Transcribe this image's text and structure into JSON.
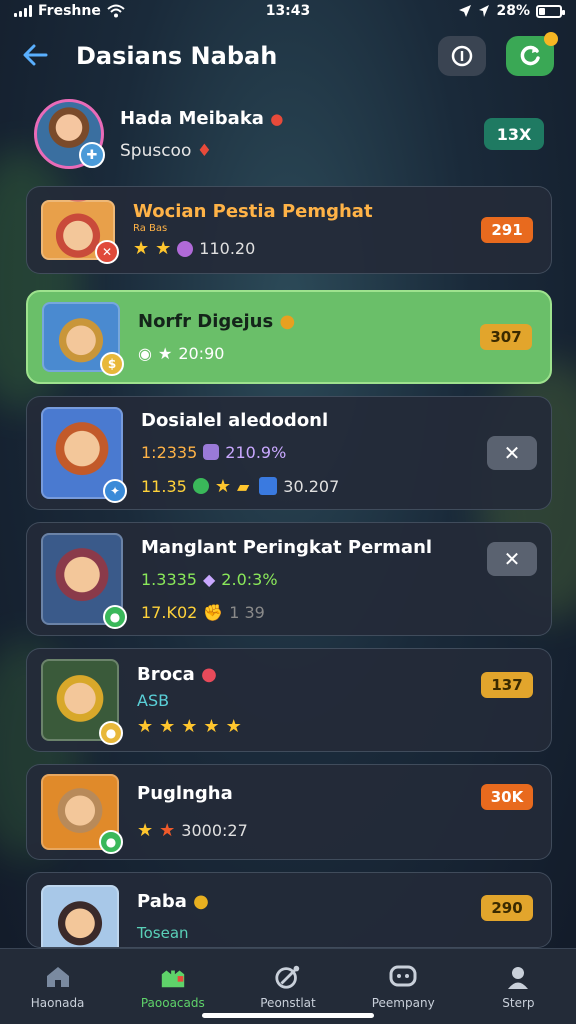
{
  "status_bar": {
    "carrier": "Freshne",
    "time": "13:43",
    "battery": "28%"
  },
  "header": {
    "title": "Dasians Nabah"
  },
  "profile": {
    "name": "Hada Meibaka",
    "subtitle": "Spuscoo",
    "button": "13X"
  },
  "cards": [
    {
      "name": "Wocian Pestia Pemghat",
      "sub": "Ra Bas",
      "stat": "110.20",
      "badge": "291"
    },
    {
      "name": "Norfr Digejus",
      "stat": "20:90",
      "badge": "307"
    },
    {
      "name": "Dosialel aledodonl",
      "line1_a": "1:2335",
      "line1_b": "210.9%",
      "line2_a": "11.35",
      "line2_b": "30.207"
    },
    {
      "name": "Manglant Peringkat Permanl",
      "line1_a": "1.3335",
      "line1_b": "2.0:3%",
      "line2_a": "17.K02",
      "line2_b": "1 39"
    },
    {
      "name": "Broca",
      "sub": "ASB",
      "badge": "137",
      "stars": 5
    },
    {
      "name": "Puglngha",
      "stat": "3000:27",
      "badge": "30K"
    },
    {
      "name": "Paba",
      "sub": "Tosean",
      "badge": "290"
    }
  ],
  "tabs": [
    {
      "label": "Haonada"
    },
    {
      "label": "Paooacads"
    },
    {
      "label": "Peonstlat"
    },
    {
      "label": "Peempany"
    },
    {
      "label": "Sterp"
    }
  ],
  "colors": {
    "accent_green": "#5fd36a",
    "active_card": "#6abf69",
    "orange_badge": "#e86a1e",
    "gold_badge": "#e2a52c"
  }
}
